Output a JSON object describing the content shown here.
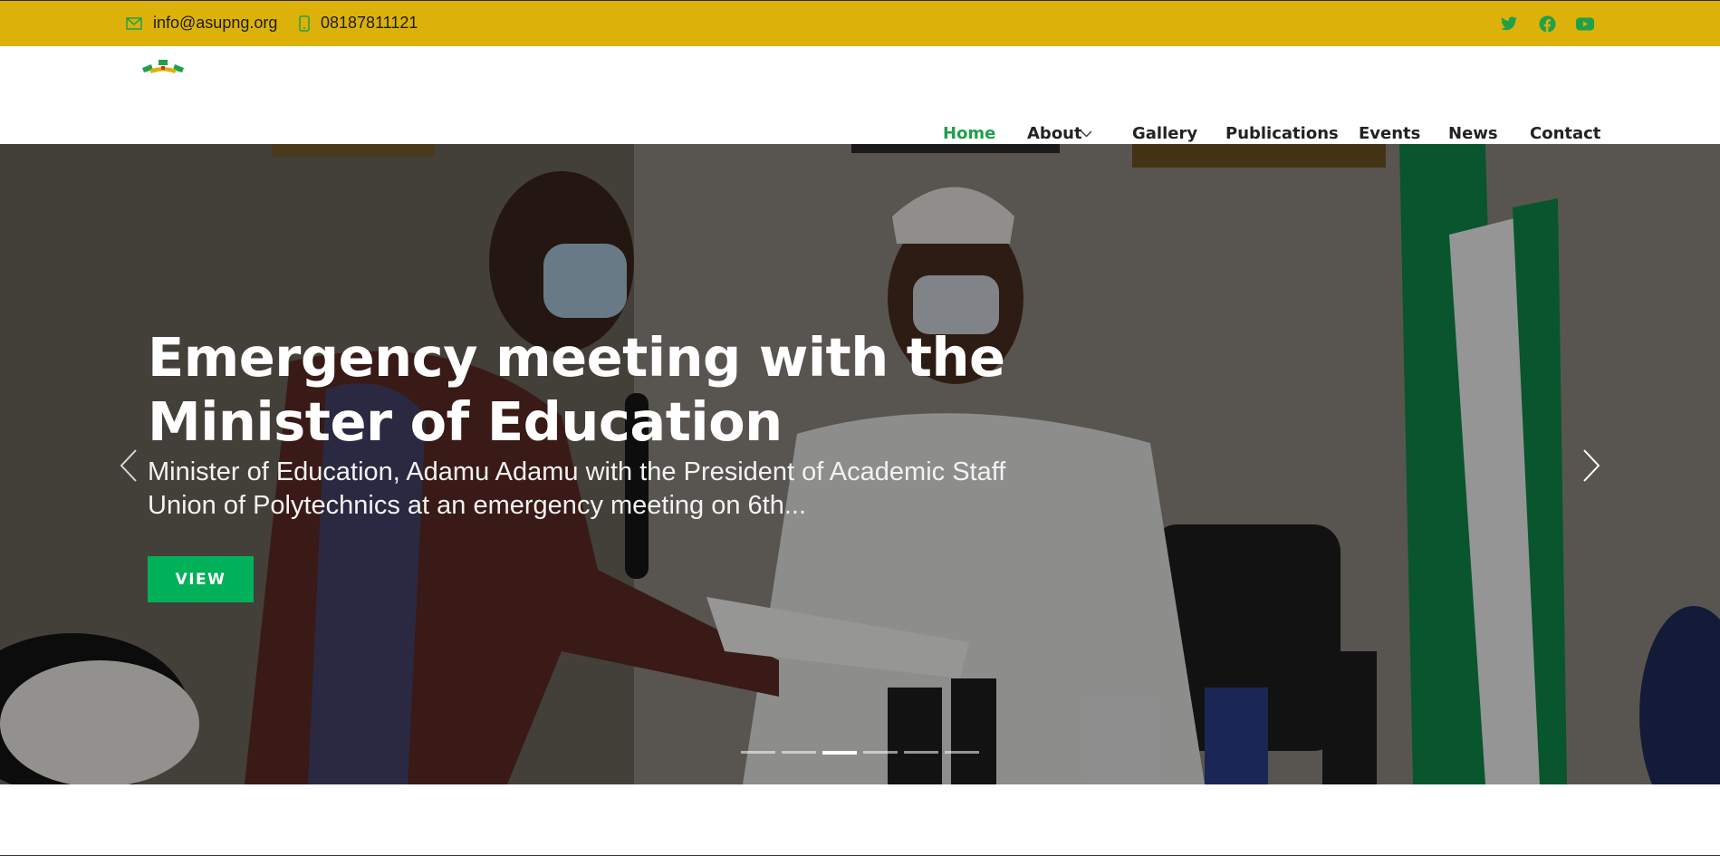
{
  "topbar": {
    "email": "info@asupng.org",
    "phone": "08187811121",
    "social": [
      {
        "icon": "twitter-icon"
      },
      {
        "icon": "facebook-icon"
      },
      {
        "icon": "youtube-icon"
      }
    ]
  },
  "colors": {
    "topbar_bg": "#dcb10a",
    "brand_green": "#1ea14a",
    "button_green": "#00b159"
  },
  "nav": {
    "items": [
      {
        "label": "Home",
        "active": true
      },
      {
        "label": "About",
        "has_dropdown": true
      },
      {
        "label": "Gallery"
      },
      {
        "label": "Publications"
      },
      {
        "label": "Events"
      },
      {
        "label": "News"
      },
      {
        "label": "Contact"
      }
    ]
  },
  "hero": {
    "title": "Emergency meeting with the Minister of Education",
    "description": "Minister of Education, Adamu Adamu with the President of Academic Staff Union of Polytechnics at an emergency meeting on 6th...",
    "button_label": "VIEW",
    "slides_count": 6,
    "active_slide": 3
  }
}
